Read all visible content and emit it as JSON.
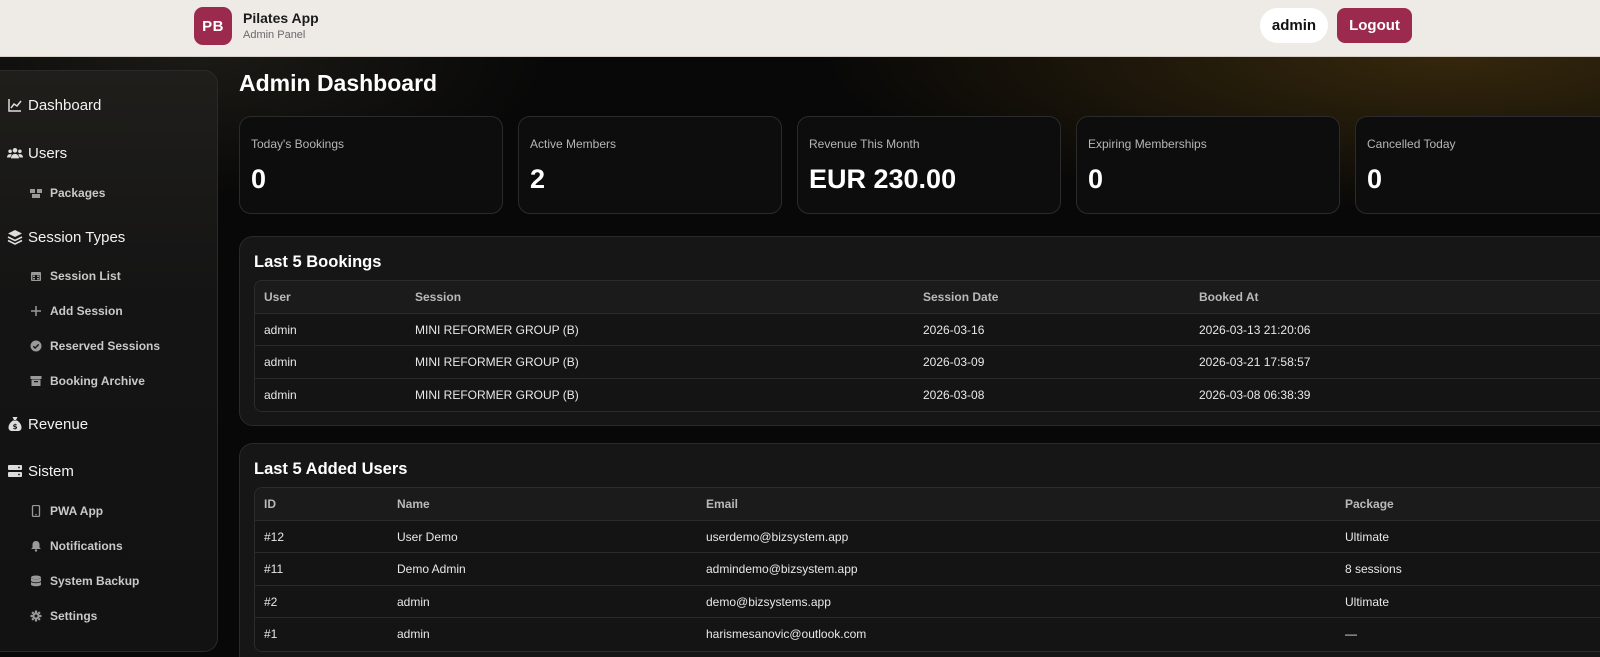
{
  "header": {
    "logo_initials": "PB",
    "app_title": "Pilates App",
    "app_subtitle": "Admin Panel",
    "user_label": "admin",
    "logout_label": "Logout",
    "accent_color": "#9b2a4e"
  },
  "sidebar": {
    "dashboard": "Dashboard",
    "users": "Users",
    "packages": "Packages",
    "session_types": "Session Types",
    "session_list": "Session List",
    "add_session": "Add Session",
    "reserved_sessions": "Reserved Sessions",
    "booking_archive": "Booking Archive",
    "revenue": "Revenue",
    "sistem": "Sistem",
    "pwa_app": "PWA App",
    "notifications": "Notifications",
    "system_backup": "System Backup",
    "settings": "Settings"
  },
  "main": {
    "title": "Admin Dashboard",
    "stats": [
      {
        "label": "Today's Bookings",
        "value": "0"
      },
      {
        "label": "Active Members",
        "value": "2"
      },
      {
        "label": "Revenue This Month",
        "value": "EUR 230.00"
      },
      {
        "label": "Expiring Memberships",
        "value": "0"
      },
      {
        "label": "Cancelled Today",
        "value": "0"
      }
    ],
    "bookings": {
      "title": "Last 5 Bookings",
      "columns": [
        "User",
        "Session",
        "Session Date",
        "Booked At"
      ],
      "rows": [
        [
          "admin",
          "MINI REFORMER GROUP (B)",
          "2026-03-16",
          "2026-03-13 21:20:06"
        ],
        [
          "admin",
          "MINI REFORMER GROUP (B)",
          "2026-03-09",
          "2026-03-21 17:58:57"
        ],
        [
          "admin",
          "MINI REFORMER GROUP (B)",
          "2026-03-08",
          "2026-03-08 06:38:39"
        ]
      ]
    },
    "users": {
      "title": "Last 5 Added Users",
      "columns": [
        "ID",
        "Name",
        "Email",
        "Package"
      ],
      "rows": [
        [
          "#12",
          "User Demo",
          "userdemo@bizsystem.app",
          "Ultimate"
        ],
        [
          "#11",
          "Demo Admin",
          "admindemo@bizsystem.app",
          "8 sessions"
        ],
        [
          "#2",
          "admin",
          "demo@bizsystems.app",
          "Ultimate"
        ],
        [
          "#1",
          "admin",
          "harismesanovic@outlook.com",
          "—"
        ]
      ]
    }
  }
}
